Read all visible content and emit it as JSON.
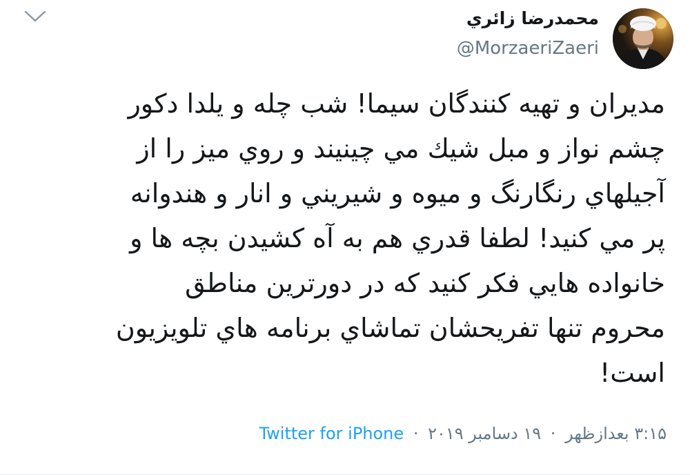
{
  "author": {
    "display_name": "محمدرضا زائري",
    "handle": "@MorzaeriZaeri"
  },
  "tweet": {
    "lines": [
      "مديران و تهيه كنندگان سيما! شب چله و يلدا دكور",
      "چشم نواز و مبل شيك مي چينيند و روي ميز را از",
      "آجيلهاي رنگارنگ و ميوه و شيريني و انار و هندوانه",
      "پر مي كنيد! لطفا قدري هم به آه كشيدن بچه ها و",
      "خانواده هايي فكر كنيد كه در دورترين مناطق",
      "محروم تنها تفريحشان تماشاي برنامه هاي تلويزيون",
      "است!"
    ]
  },
  "meta": {
    "time": "۳:۱۵ بعدازظهر",
    "date": "۱۹ دسامبر ۲۰۱۹",
    "source": "Twitter for iPhone",
    "separator": "·"
  },
  "icons": {
    "avatar": "avatar-photo",
    "menu": "chevron-down-icon"
  },
  "colors": {
    "text": "#14171a",
    "secondary": "#657786",
    "link": "#1da1f2",
    "caret": "#8899a6"
  }
}
